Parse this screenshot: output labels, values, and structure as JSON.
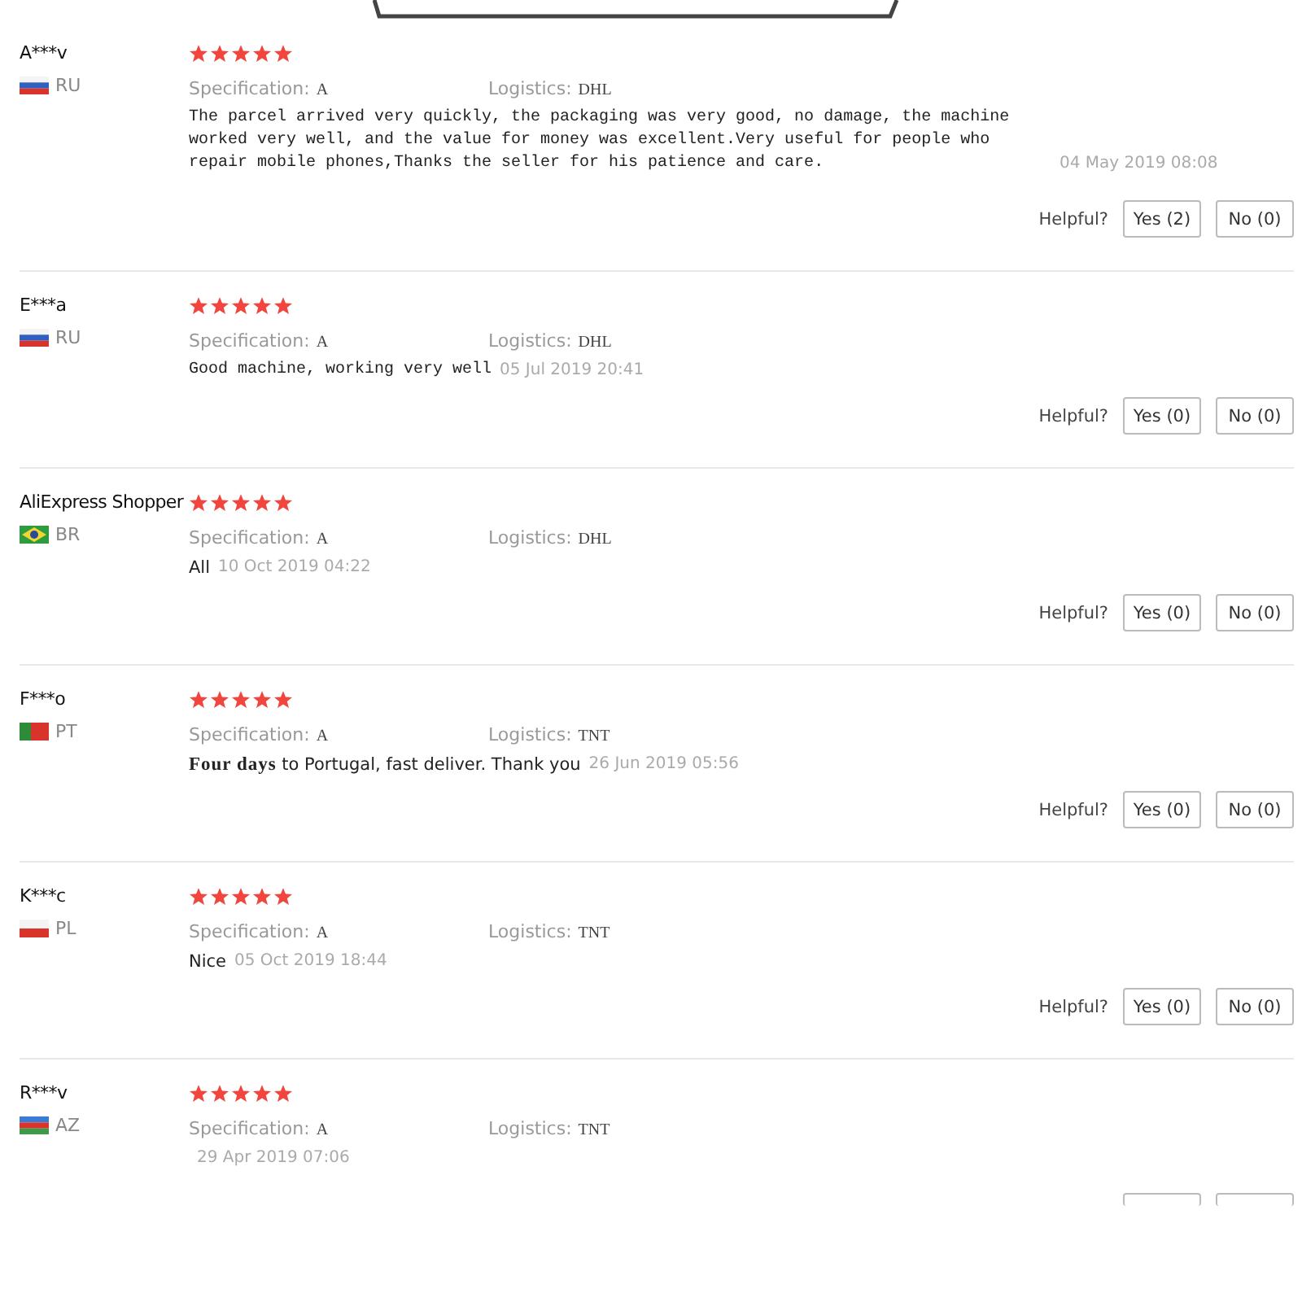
{
  "reviews": [
    {
      "name": "A***v",
      "country": "RU",
      "flag": {
        "kind": "ru"
      },
      "stars": 5,
      "spec_label": "Specification:",
      "spec": "A",
      "logistics_label": "Logistics:",
      "logistics": "DHL",
      "kind": "typed",
      "text": "The parcel arrived very quickly, the packaging was very good, no damage, the machine worked very well, and the value for money was excellent.Very useful for people who repair mobile phones,Thanks the seller for his patience and care.",
      "date": "04 May 2019 08:08",
      "helpful": "Helpful?",
      "yes": "Yes (2)",
      "no": "No (0)"
    },
    {
      "name": "E***a",
      "country": "RU",
      "flag": {
        "kind": "ru"
      },
      "stars": 5,
      "spec_label": "Specification:",
      "spec": "A",
      "logistics_label": "Logistics:",
      "logistics": "DHL",
      "kind": "typed",
      "text": "Good machine, working very well",
      "date": "05 Jul 2019 20:41",
      "helpful": "Helpful?",
      "yes": "Yes (0)",
      "no": "No (0)"
    },
    {
      "name": "AliExpress Shopper",
      "country": "BR",
      "flag": {
        "kind": "br"
      },
      "stars": 5,
      "spec_label": "Specification:",
      "spec": "A",
      "logistics_label": "Logistics:",
      "logistics": "DHL",
      "kind": "plain",
      "text": "All",
      "date": "10 Oct 2019 04:22",
      "helpful": "Helpful?",
      "yes": "Yes (0)",
      "no": "No (0)"
    },
    {
      "name": "F***o",
      "country": "PT",
      "flag": {
        "kind": "pt"
      },
      "stars": 5,
      "spec_label": "Specification:",
      "spec": "A",
      "logistics_label": "Logistics:",
      "logistics": "TNT",
      "kind": "plain",
      "text": "**Four days** to Portugal, fast deliver. Thank you",
      "date": "26 Jun 2019 05:56",
      "helpful": "Helpful?",
      "yes": "Yes (0)",
      "no": "No (0)"
    },
    {
      "name": "K***c",
      "country": "PL",
      "flag": {
        "kind": "pl"
      },
      "stars": 5,
      "spec_label": "Specification:",
      "spec": "A",
      "logistics_label": "Logistics:",
      "logistics": "TNT",
      "kind": "plain",
      "text": "Nice",
      "date": "05 Oct 2019 18:44",
      "helpful": "Helpful?",
      "yes": "Yes (0)",
      "no": "No (0)"
    },
    {
      "name": "R***v",
      "country": "AZ",
      "flag": {
        "kind": "az"
      },
      "stars": 5,
      "spec_label": "Specification:",
      "spec": "A",
      "logistics_label": "Logistics:",
      "logistics": "TNT",
      "date": "29 Apr 2019 07:06",
      "cut_off": true
    }
  ]
}
